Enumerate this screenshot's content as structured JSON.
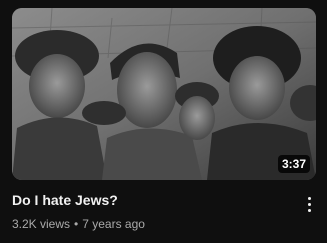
{
  "video": {
    "title": "Do I hate Jews?",
    "duration": "3:37",
    "views": "3.2K views",
    "separator": "•",
    "age": "7 years ago"
  },
  "thumbnail": {
    "style": "black-and-white photograph of soldiers in helmets"
  },
  "icons": {
    "menu": "more-vert-icon"
  },
  "colors": {
    "background": "#0f0f0f",
    "title": "#f1f1f1",
    "meta": "#aaaaaa",
    "duration_bg": "#000000cc"
  }
}
